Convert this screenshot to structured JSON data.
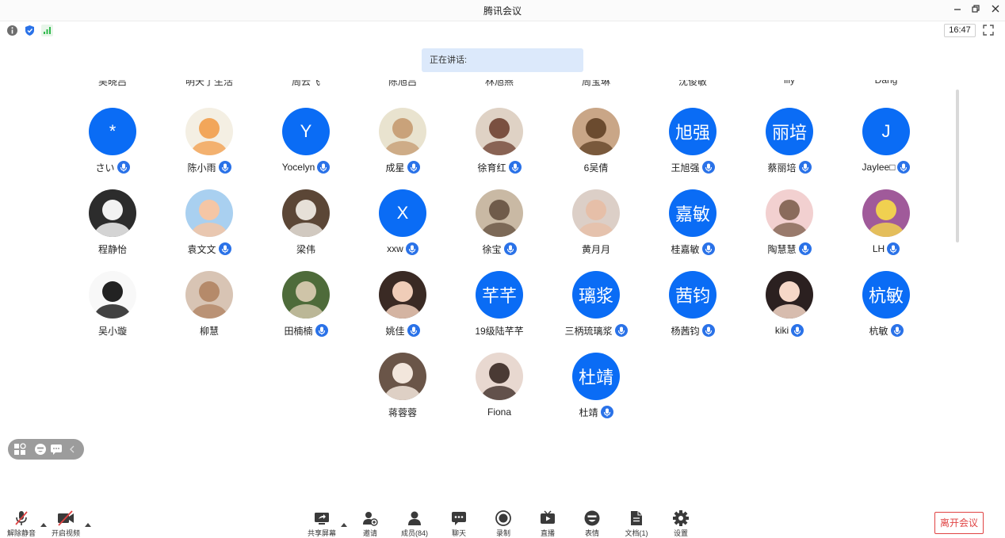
{
  "window": {
    "title": "腾讯会议"
  },
  "status": {
    "time": "16:47"
  },
  "speaking": {
    "label": "正在讲话:"
  },
  "participants": [
    {
      "name": "さい",
      "avatar_text": "*",
      "mic": true
    },
    {
      "name": "陈小雨",
      "mic": true
    },
    {
      "name": "Yocelyn",
      "avatar_text": "Y",
      "mic": true
    },
    {
      "name": "成星",
      "mic": true
    },
    {
      "name": "徐育红",
      "mic": true
    },
    {
      "name": "6吴倩",
      "mic": false
    },
    {
      "name": "王旭强",
      "avatar_text": "旭强",
      "mic": true
    },
    {
      "name": "蔡丽培",
      "avatar_text": "丽培",
      "mic": true
    },
    {
      "name": "Jaylee□",
      "avatar_text": "J",
      "mic": true
    },
    {
      "name": "程静怡",
      "mic": false
    },
    {
      "name": "袁文文",
      "mic": true
    },
    {
      "name": "梁伟",
      "mic": false
    },
    {
      "name": "xxw",
      "avatar_text": "X",
      "mic": true
    },
    {
      "name": "徐宝",
      "mic": true
    },
    {
      "name": "黄月月",
      "mic": false
    },
    {
      "name": "桂嘉敏",
      "avatar_text": "嘉敏",
      "mic": true
    },
    {
      "name": "陶慧慧",
      "mic": true
    },
    {
      "name": "LH",
      "mic": true
    },
    {
      "name": "吴小璇",
      "mic": false
    },
    {
      "name": "柳慧",
      "mic": false
    },
    {
      "name": "田楠楠",
      "mic": true
    },
    {
      "name": "姚佳",
      "mic": true
    },
    {
      "name": "19级陆芊芊",
      "avatar_text": "芊芊",
      "mic": false
    },
    {
      "name": "三柄琉璃浆",
      "avatar_text": "璃浆",
      "mic": true
    },
    {
      "name": "杨茜钧",
      "avatar_text": "茜钧",
      "mic": true
    },
    {
      "name": "kiki",
      "mic": true
    },
    {
      "name": "杭敏",
      "avatar_text": "杭敏",
      "mic": true
    },
    {
      "name": "蒋蓉蓉",
      "mic": false
    },
    {
      "name": "Fiona",
      "mic": false
    },
    {
      "name": "杜靖",
      "avatar_text": "杜靖",
      "mic": true
    }
  ],
  "cut_row_names": [
    "吴晓吕",
    "明天了生活",
    "周云飞",
    "陈旭吕",
    "林旭燕",
    "周宝琳",
    "沈俊敏",
    "lily",
    "Dang"
  ],
  "toolbar": {
    "unmute": "解除静音",
    "start_video": "开启视频",
    "share_screen": "共享屏幕",
    "invite": "邀请",
    "members": "成员(84)",
    "chat": "聊天",
    "record": "录制",
    "live": "直播",
    "reactions": "表情",
    "docs": "文档(1)",
    "settings": "设置",
    "leave": "离开会议"
  },
  "colors": {
    "accent": "#0a6cf5",
    "leave": "#e04343",
    "banner": "#dce9fb"
  }
}
